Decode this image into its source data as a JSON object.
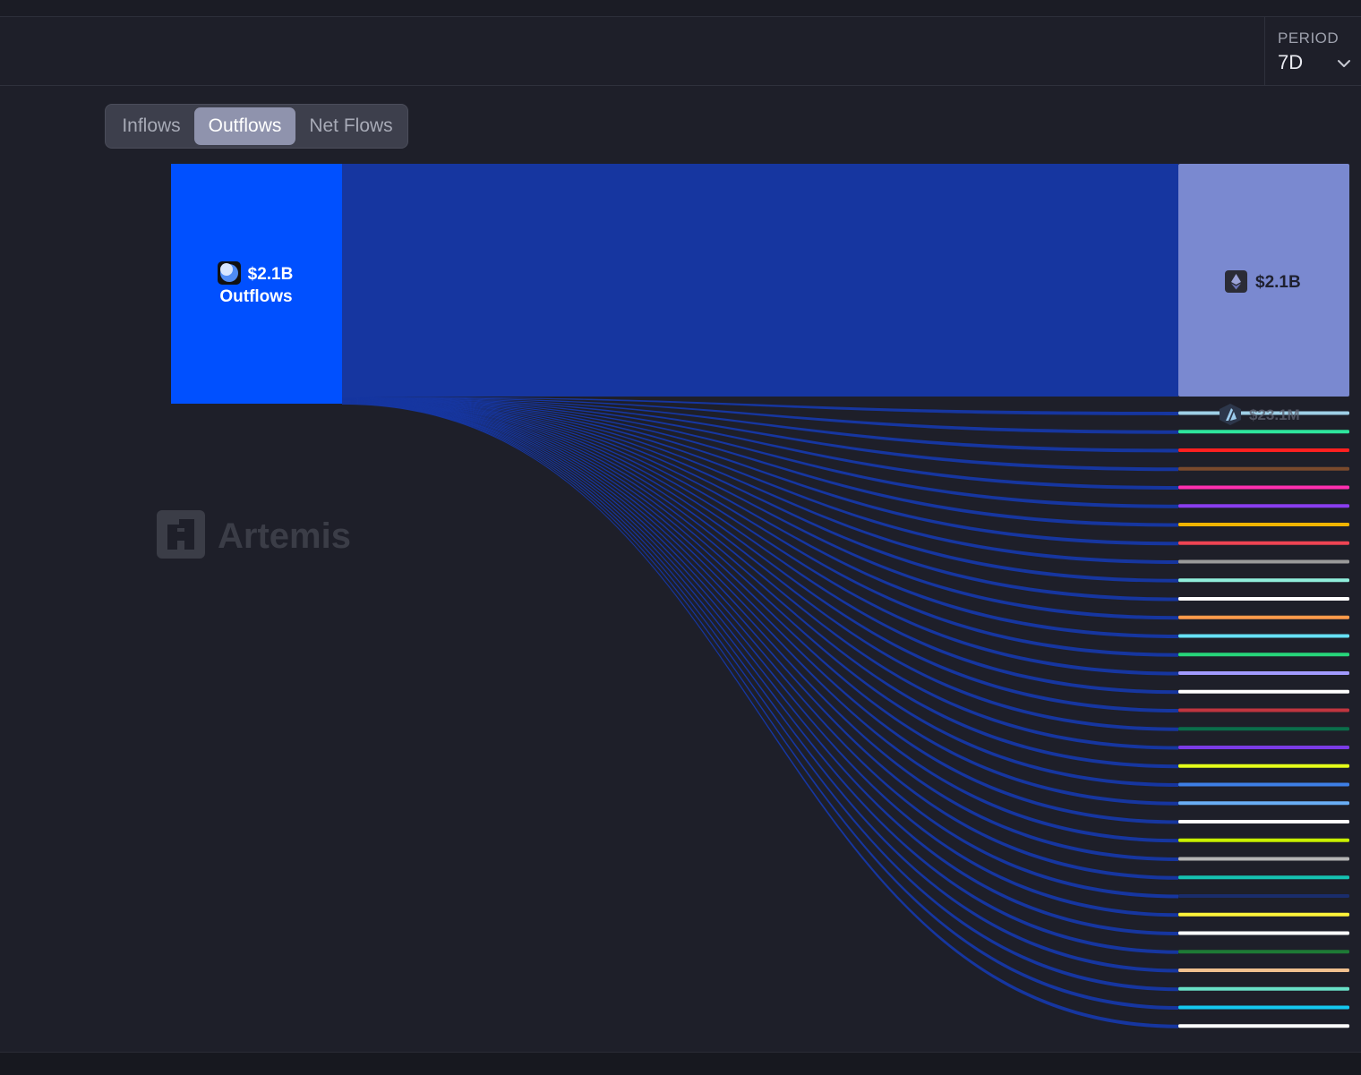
{
  "period": {
    "label": "PERIOD",
    "value": "7D",
    "chevron_icon": "chevron-down-icon"
  },
  "tabs": [
    {
      "label": "Inflows",
      "active": false
    },
    {
      "label": "Outflows",
      "active": true
    },
    {
      "label": "Net Flows",
      "active": false
    }
  ],
  "watermark": {
    "text": "Artemis",
    "icon": "artemis-logo-icon"
  },
  "chart_data": {
    "type": "sankey",
    "source": {
      "amount": "$2.1B",
      "label": "Outflows",
      "icon": "chain-orb-icon",
      "color": "#0050ff"
    },
    "link_color": "#1636a0",
    "targets": [
      {
        "amount": "$2.1B",
        "icon": "ethereum-icon",
        "color": "#7a89d0",
        "weight": 2100
      },
      {
        "amount": "$23.1M",
        "icon": "arbitrum-icon",
        "color": "#9ecfe6",
        "weight": 23.1
      },
      {
        "color": "#2ee59d",
        "weight": 1
      },
      {
        "color": "#ff2020",
        "weight": 1
      },
      {
        "color": "#7a4a2c",
        "weight": 1
      },
      {
        "color": "#ff2fb0",
        "weight": 1
      },
      {
        "color": "#8a3df0",
        "weight": 1
      },
      {
        "color": "#f0b400",
        "weight": 1
      },
      {
        "color": "#ef4453",
        "weight": 1
      },
      {
        "color": "#9a9a9a",
        "weight": 1
      },
      {
        "color": "#90efdd",
        "weight": 1
      },
      {
        "color": "#ffffff",
        "weight": 1
      },
      {
        "color": "#ff9a4a",
        "weight": 1
      },
      {
        "color": "#66e0f5",
        "weight": 1
      },
      {
        "color": "#27d67a",
        "weight": 1
      },
      {
        "color": "#a19aff",
        "weight": 1
      },
      {
        "color": "#ffffff",
        "weight": 1
      },
      {
        "color": "#c0353f",
        "weight": 1
      },
      {
        "color": "#0a6e4a",
        "weight": 1
      },
      {
        "color": "#7b3be6",
        "weight": 1
      },
      {
        "color": "#e5ff1a",
        "weight": 1
      },
      {
        "color": "#3e7fe6",
        "weight": 1
      },
      {
        "color": "#69aef5",
        "weight": 1
      },
      {
        "color": "#ffffff",
        "weight": 1
      },
      {
        "color": "#c8f000",
        "weight": 1
      },
      {
        "color": "#b5b5b5",
        "weight": 1
      },
      {
        "color": "#15c2b2",
        "weight": 1
      },
      {
        "color": "#1a2d6c",
        "weight": 1
      },
      {
        "color": "#fff33a",
        "weight": 1
      },
      {
        "color": "#ffffff",
        "weight": 1
      },
      {
        "color": "#1e7a35",
        "weight": 1
      },
      {
        "color": "#f0c08f",
        "weight": 1
      },
      {
        "color": "#69e0c8",
        "weight": 1
      },
      {
        "color": "#14c8f0",
        "weight": 1
      },
      {
        "color": "#ffffff",
        "weight": 1
      }
    ]
  }
}
